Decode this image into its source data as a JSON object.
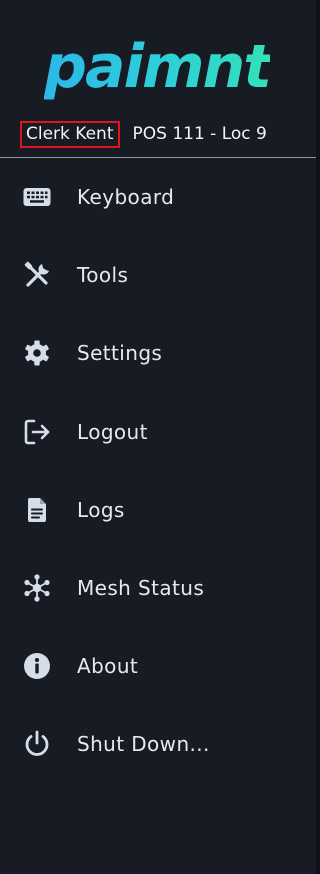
{
  "brand": {
    "logo_text": "paimnt"
  },
  "session": {
    "user_name": "Clerk Kent",
    "terminal": "POS 111 - Loc 9"
  },
  "menu": {
    "items": [
      {
        "label": "Keyboard",
        "icon": "keyboard-icon"
      },
      {
        "label": "Tools",
        "icon": "tools-icon"
      },
      {
        "label": "Settings",
        "icon": "gear-icon"
      },
      {
        "label": "Logout",
        "icon": "logout-icon"
      },
      {
        "label": "Logs",
        "icon": "document-icon"
      },
      {
        "label": "Mesh Status",
        "icon": "mesh-network-icon"
      },
      {
        "label": "About",
        "icon": "info-icon"
      },
      {
        "label": "Shut Down...",
        "icon": "power-icon"
      }
    ]
  },
  "colors": {
    "background": "#171c24",
    "text": "#e6e9ee",
    "icon": "#d7dde8",
    "highlight_border": "#e0151c",
    "logo_gradient_start": "#2bb8ea",
    "logo_gradient_end": "#34e0b9",
    "divider": "#8e96a3"
  }
}
